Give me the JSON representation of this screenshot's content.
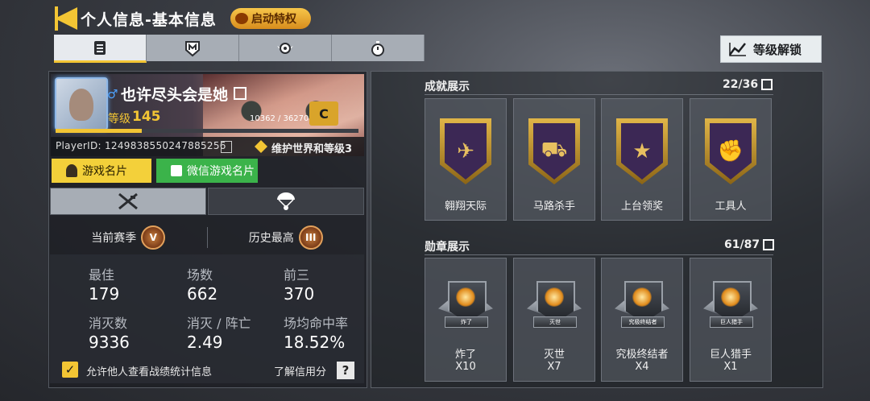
{
  "header": {
    "title": "个人信息-基本信息",
    "privilege_label": "启动特权",
    "unlock_label": "等级解锁"
  },
  "top_tabs": [
    {
      "icon": "clipboard-icon",
      "active": true
    },
    {
      "icon": "shield-m-icon",
      "active": false
    },
    {
      "icon": "winged-badge-icon",
      "active": false
    },
    {
      "icon": "stopwatch-icon",
      "active": false
    }
  ],
  "profile": {
    "name": "也许尽头会是她",
    "gender_symbol": "♂",
    "level_label": "等级",
    "level": "145",
    "xp_text": "10362 / 36270",
    "xp_fraction": 0.2857,
    "rank_badge": "C",
    "player_id": "PlayerID: 1249838550247885256",
    "world_text": "维护世界和等级3"
  },
  "cards": {
    "game_card": "游戏名片",
    "wechat_card": "微信游戏名片"
  },
  "season": {
    "current_label": "当前赛季",
    "current_rank": "V",
    "best_label": "历史最高",
    "best_rank": "III"
  },
  "stats": [
    {
      "label": "最佳",
      "value": "179"
    },
    {
      "label": "场数",
      "value": "662"
    },
    {
      "label": "前三",
      "value": "370"
    },
    {
      "label": "消灭数",
      "value": "9336"
    },
    {
      "label": "消灭 / 阵亡",
      "value": "2.49"
    },
    {
      "label": "场均命中率",
      "value": "18.52%"
    }
  ],
  "footer": {
    "allow_label": "允许他人查看战绩统计信息",
    "allow_checked": true,
    "credit_label": "了解信用分",
    "help_symbol": "?"
  },
  "achievements": {
    "title": "成就展示",
    "count": "22/36",
    "items": [
      {
        "name": "翱翔天际",
        "icon": "winged-figure-icon",
        "glyph": "✈"
      },
      {
        "name": "马路杀手",
        "icon": "jeep-icon",
        "glyph": "⛟"
      },
      {
        "name": "上台领奖",
        "icon": "trophy-wreath-icon",
        "glyph": "★"
      },
      {
        "name": "工具人",
        "icon": "thumbs-up-icon",
        "glyph": "✊"
      }
    ]
  },
  "medals": {
    "title": "勋章展示",
    "count": "61/87",
    "items": [
      {
        "name": "炸了",
        "count": "X10",
        "ribbon": "炸了",
        "icon": "explosion-medal-icon"
      },
      {
        "name": "灭世",
        "count": "X7",
        "ribbon": "灭世",
        "icon": "radiation-medal-icon"
      },
      {
        "name": "究极终结者",
        "count": "X4",
        "ribbon": "究极终结者",
        "icon": "skull-medal-icon"
      },
      {
        "name": "巨人猎手",
        "count": "X1",
        "ribbon": "巨人猎手",
        "icon": "giant-hunter-medal-icon"
      }
    ]
  }
}
